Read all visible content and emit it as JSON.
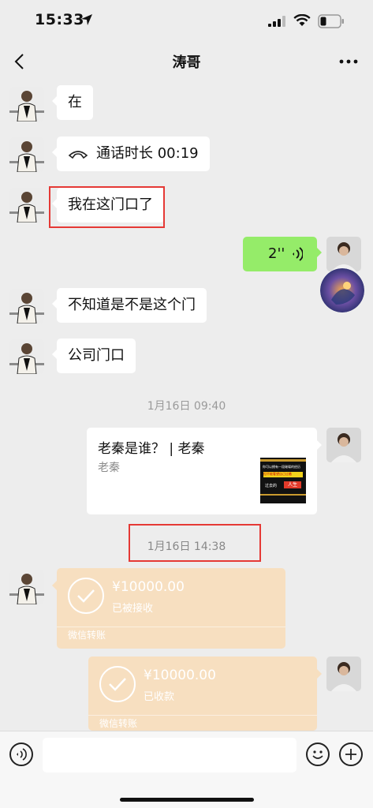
{
  "status_bar": {
    "time": "15:33"
  },
  "nav": {
    "title": "涛哥"
  },
  "messages": {
    "m1": "在",
    "m2_call": "通话时长 00:19",
    "m3": "我在这门口了",
    "m4_voice": "2''",
    "m5": "不知道是不是这个门",
    "m6": "公司门口"
  },
  "timestamps": {
    "t1": "1月16日 09:40",
    "t2": "1月16日 14:38"
  },
  "link_card": {
    "title": "老秦是谁？ | 老秦",
    "source": "老秦",
    "thumb_line1": "你可以拥有一段璀璨的经历",
    "thumb_line2": "但不能奢望自己过着",
    "thumb_line3": "过去的",
    "thumb_line4": "人生"
  },
  "transfer1": {
    "amount": "¥10000.00",
    "status": "已被接收",
    "brand": "微信转账"
  },
  "transfer2": {
    "amount": "¥10000.00",
    "status": "已收款",
    "brand": "微信转账"
  },
  "colors": {
    "accent_green": "#95ec69",
    "transfer_orange": "#f7dfc0",
    "highlight_red": "#e53935"
  }
}
